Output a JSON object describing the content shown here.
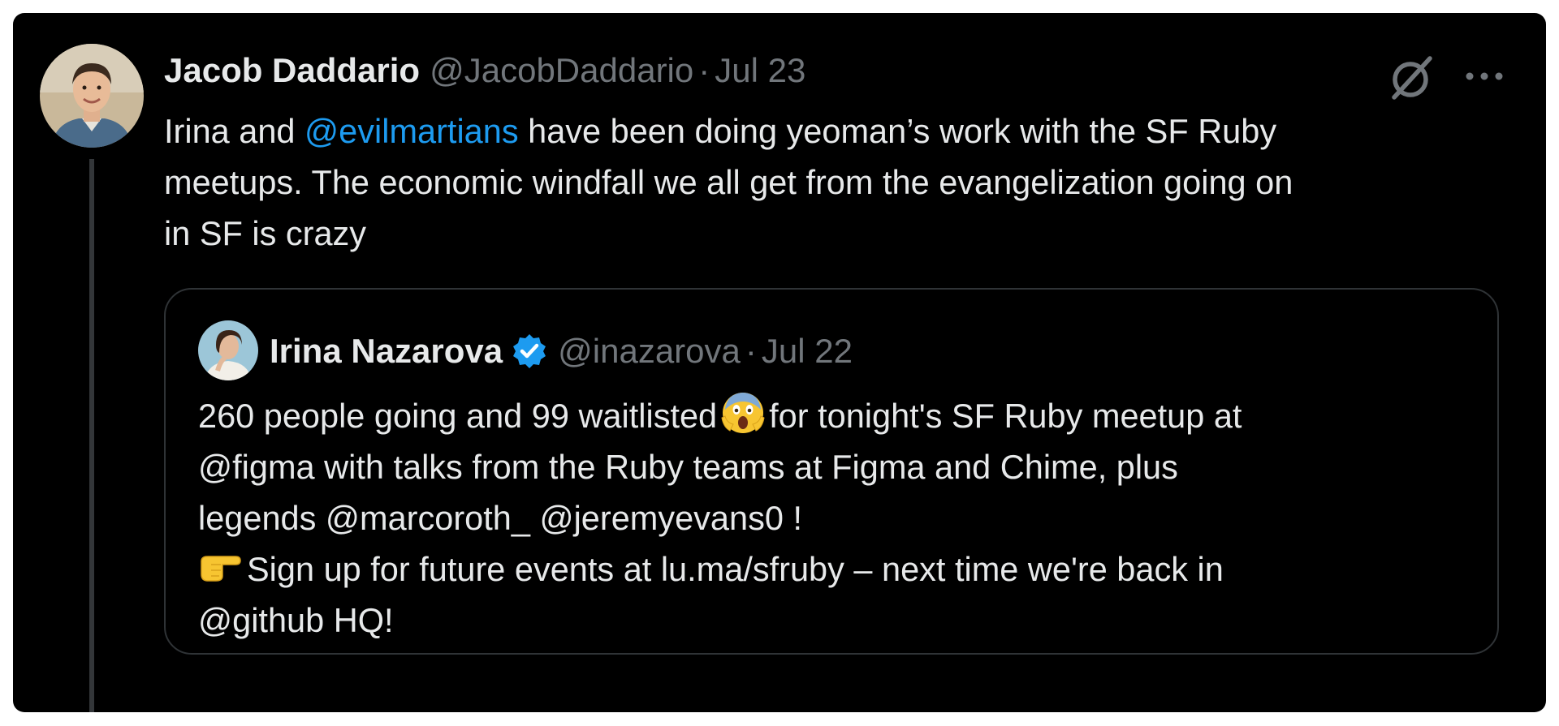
{
  "tweet": {
    "author_name": "Jacob Daddario",
    "handle": "@JacobDaddario",
    "separator": "·",
    "date": "Jul 23",
    "text_part1": "Irina and ",
    "mention": "@evilmartians",
    "text_line1_rest": " have been doing yeoman’s work with the SF Ruby",
    "text_line2": "meetups. The economic windfall we all get from the evangelization going on",
    "text_line3": "in SF is crazy",
    "icons": {
      "grok": "grok-icon",
      "more": "more-icon",
      "avatar": "avatar"
    }
  },
  "quoted_tweet": {
    "author_name": "Irina Nazarova",
    "handle": "@inazarova",
    "separator": "·",
    "date": "Jul 22",
    "verified": true,
    "verified_color": "#1d9bf0",
    "line1_before": "260 people going and 99 waitlisted",
    "line1_after": "for tonight's SF Ruby meetup at",
    "line2": "@figma with talks from the Ruby teams at Figma and Chime, plus",
    "line3": "legends @marcoroth_ @jeremyevans0 !",
    "line4_after": "Sign up for future events at lu.ma/sfruby – next time we're back in",
    "line5": "@github HQ!",
    "emojis": [
      "screaming-face-emoji",
      "pointing-right-emoji"
    ]
  },
  "colors": {
    "background": "#000000",
    "text": "#e7e9ea",
    "muted": "#71767b",
    "link": "#1d9bf0",
    "border": "#2f3336"
  }
}
